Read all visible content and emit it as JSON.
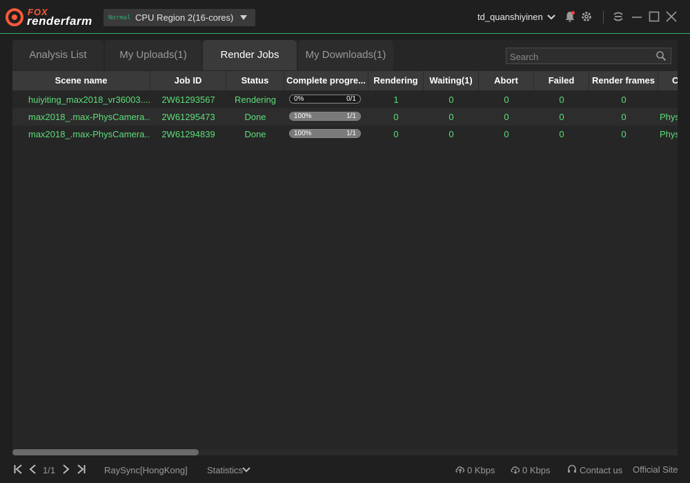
{
  "app": {
    "logo_top": "FOX",
    "logo_bottom": "renderfarm",
    "region_tag": "Normal",
    "region_label": "CPU Region 2(16-cores)",
    "username": "td_quanshiyinen"
  },
  "tabs": [
    {
      "label": "Analysis List",
      "active": false
    },
    {
      "label": "My Uploads(1)",
      "active": false
    },
    {
      "label": "Render Jobs",
      "active": true
    },
    {
      "label": "My Downloads(1)",
      "active": false
    }
  ],
  "search": {
    "placeholder": "Search"
  },
  "table": {
    "headers": [
      "Scene name",
      "Job ID",
      "Status",
      "Complete progre...",
      "Rendering",
      "Waiting(1)",
      "Abort",
      "Failed",
      "Render frames",
      "C"
    ],
    "rows": [
      {
        "scene": "huiyiting_max2018_vr36003....",
        "job_id": "2W61293567",
        "status": "Rendering",
        "progress_label": "0%",
        "progress_value": 0,
        "frames": "0/1",
        "rendering": "1",
        "waiting": "0",
        "abort": "0",
        "failed": "0",
        "render_frames": "0",
        "extra": ""
      },
      {
        "scene": "max2018_.max-PhysCamera...",
        "job_id": "2W61295473",
        "status": "Done",
        "progress_label": "100%",
        "progress_value": 100,
        "frames": "1/1",
        "rendering": "0",
        "waiting": "0",
        "abort": "0",
        "failed": "0",
        "render_frames": "0",
        "extra": "Phys"
      },
      {
        "scene": "max2018_.max-PhysCamera...",
        "job_id": "2W61294839",
        "status": "Done",
        "progress_label": "100%",
        "progress_value": 100,
        "frames": "1/1",
        "rendering": "0",
        "waiting": "0",
        "abort": "0",
        "failed": "0",
        "render_frames": "0",
        "extra": "Phys"
      }
    ]
  },
  "footer": {
    "page": "1/1",
    "raysync": "RaySync[HongKong]",
    "statistics": "Statistics",
    "upload_speed": "0 Kbps",
    "download_speed": "0 Kbps",
    "contact": "Contact us",
    "official": "Official Site"
  },
  "colors": {
    "accent": "#2fae6a",
    "row_text": "#5ddf7a",
    "brand_orange": "#ff5a3c",
    "notification_dot": "#ff3b3b"
  }
}
